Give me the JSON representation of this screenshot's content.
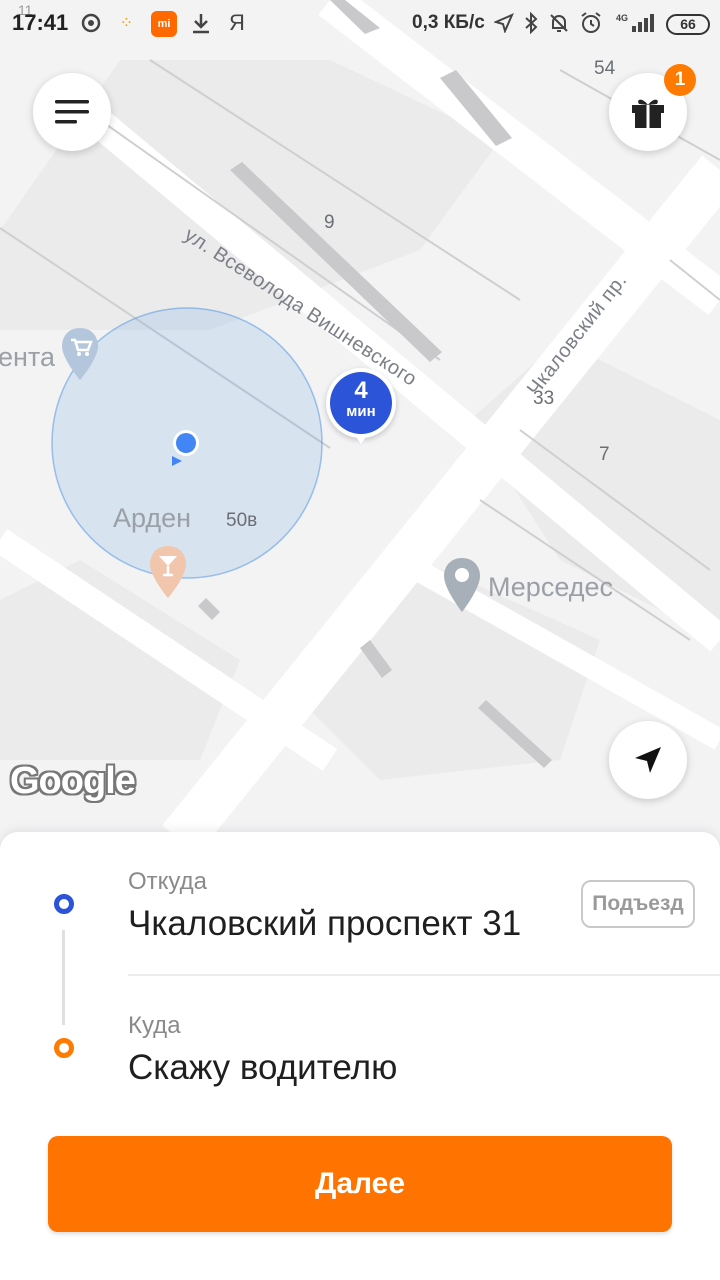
{
  "status_bar": {
    "time": "17:41",
    "network_speed": "0,3 КБ/с",
    "network_type": "4G",
    "battery": "66",
    "icons": [
      "music-icon",
      "taxi-dots-icon",
      "mi-app-icon",
      "download-icon",
      "yandex-icon",
      "location-arrow-icon",
      "bluetooth-icon",
      "mute-bell-icon",
      "alarm-icon",
      "signal-icon",
      "battery-icon"
    ],
    "mi_label": "mi",
    "yandex_label": "Я"
  },
  "map": {
    "house_numbers": {
      "n54": "54",
      "n9": "9",
      "n33": "33",
      "n7": "7",
      "n50v": "50в",
      "n11": "11"
    },
    "streets": {
      "vishnevskogo": "ул. Всеволода Вишневского",
      "chkalovsky": "Чкаловский пр."
    },
    "pois": {
      "arden": "Арден",
      "mercedes": "Мерседес",
      "lenta": "ента"
    },
    "eta": {
      "value": "4",
      "unit": "мин"
    },
    "google_logo": "Google",
    "gift_badge": "1"
  },
  "colors": {
    "accent_orange": "#ff7300",
    "route_blue": "#2c54d8",
    "location_blue": "#4285f4"
  },
  "sheet": {
    "from_label": "Откуда",
    "from_value": "Чкаловский проспект 31",
    "entrance_button": "Подъезд",
    "to_label": "Куда",
    "to_value": "Скажу водителю",
    "next_button": "Далее"
  }
}
